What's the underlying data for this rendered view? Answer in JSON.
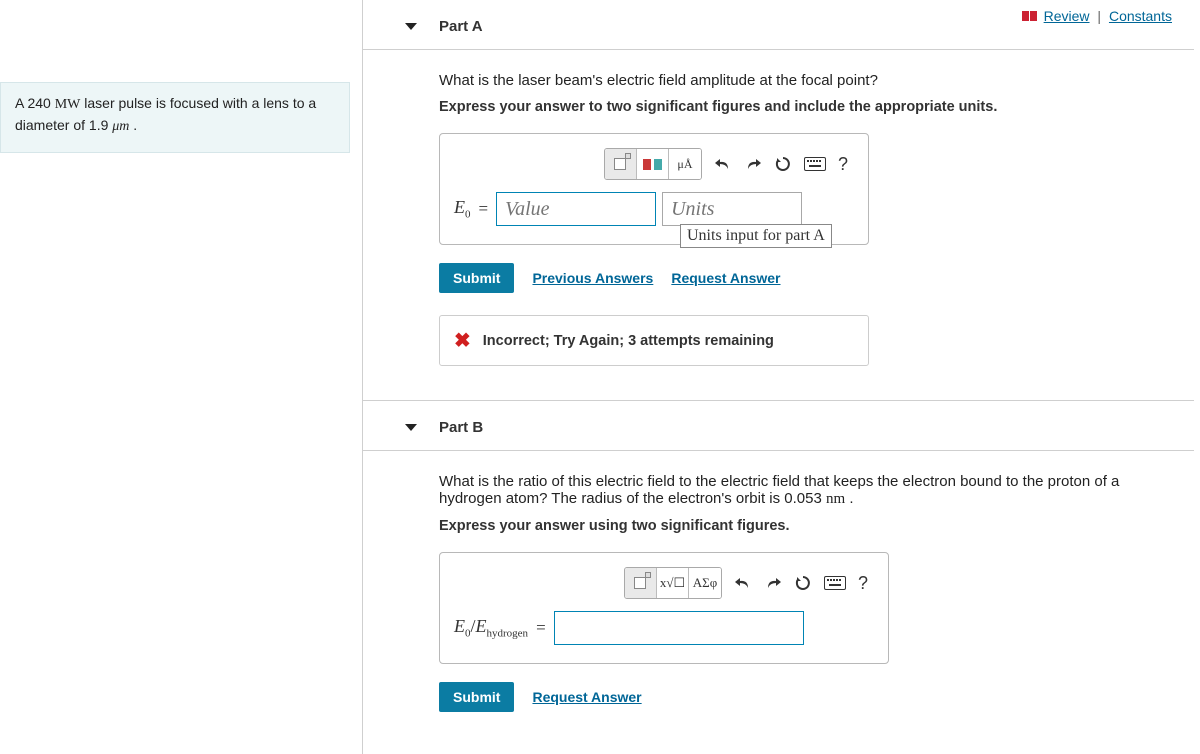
{
  "topnav": {
    "review": "Review",
    "constants": "Constants"
  },
  "problem": {
    "text_prefix": "A 240 ",
    "power_unit": "MW",
    "text_mid": " laser pulse is focused with a lens to a diameter of 1.9 ",
    "diam_unit": "μm",
    "text_suffix": " ."
  },
  "partA": {
    "title": "Part A",
    "question": "What is the laser beam's electric field amplitude at the focal point?",
    "instruction": "Express your answer to two significant figures and include the appropriate units.",
    "lhs_symbol": "E",
    "lhs_sub": "0",
    "value_placeholder": "Value",
    "units_placeholder": "Units",
    "tooltip": "Units input for part A",
    "tool_templates": "templates",
    "tool_units": "μÅ",
    "submit": "Submit",
    "previous": "Previous Answers",
    "request": "Request Answer",
    "feedback": "Incorrect; Try Again; 3 attempts remaining"
  },
  "partB": {
    "title": "Part B",
    "question_prefix": "What is the ratio of this electric field to the electric field that keeps the electron bound to the proton of a hydrogen atom? The radius of the electron's orbit is 0.053 ",
    "radius_unit": "nm",
    "question_suffix": " .",
    "instruction": "Express your answer using two significant figures.",
    "lhs_num": "E",
    "lhs_num_sub": "0",
    "lhs_den": "E",
    "lhs_den_sub": "hydrogen",
    "tool_greek": "ΑΣφ",
    "submit": "Submit",
    "request": "Request Answer"
  }
}
